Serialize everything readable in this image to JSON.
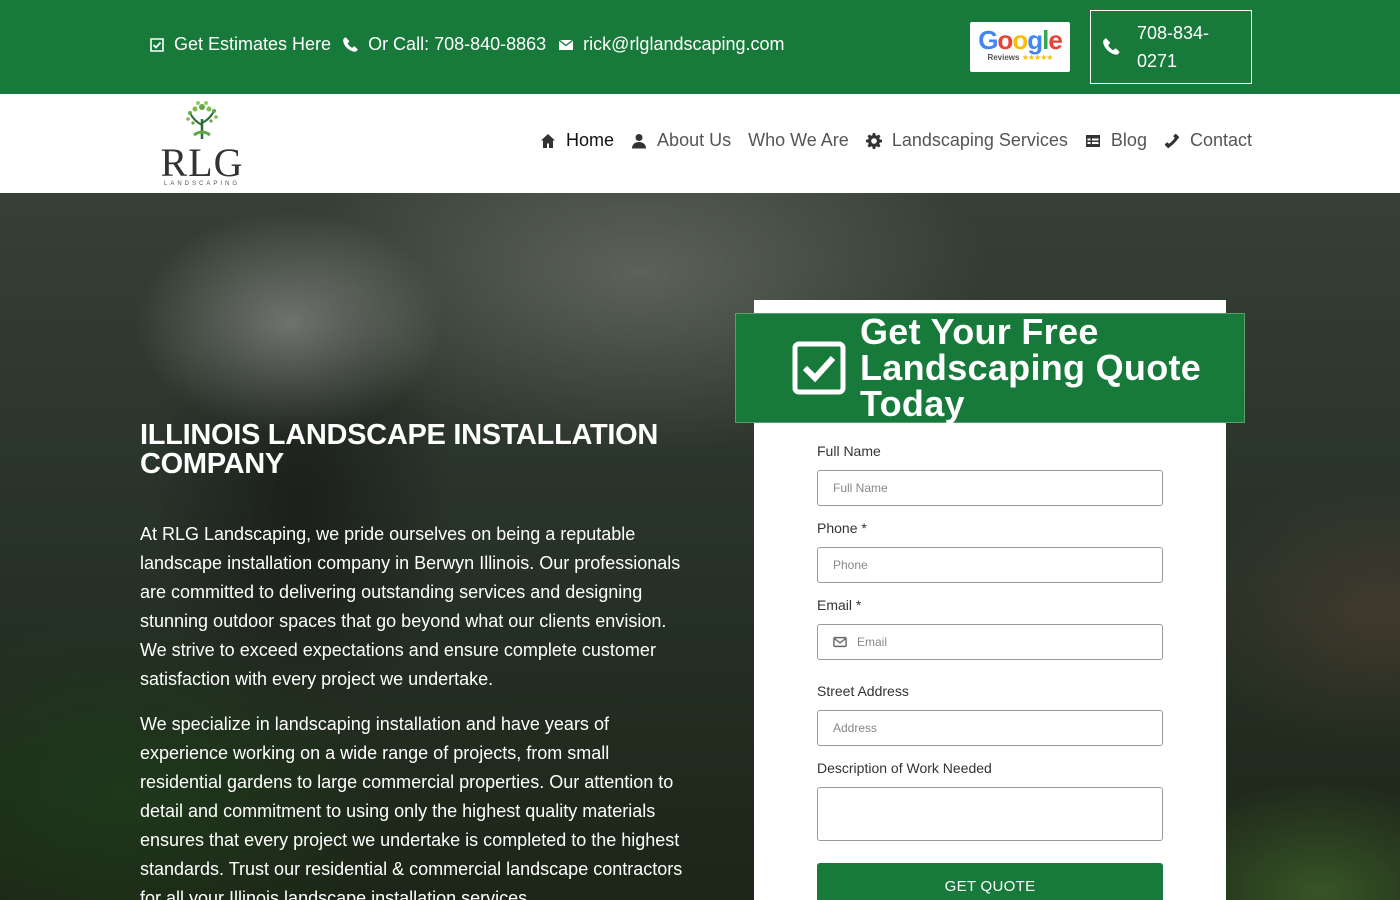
{
  "topbar": {
    "estimates_label": "Get Estimates Here",
    "call_label": "Or Call: 708-840-8863",
    "email": "rick@rlglandscaping.com",
    "google_word": [
      "G",
      "o",
      "o",
      "g",
      "l",
      "e"
    ],
    "google_sub": "Reviews",
    "google_stars": "★★★★★",
    "phone_button": "708-834-0271"
  },
  "header": {
    "logo_word": "RLG",
    "logo_sub": "LANDSCAPING",
    "nav": [
      {
        "label": "Home",
        "icon": "home-icon",
        "active": true
      },
      {
        "label": "About Us",
        "icon": "user-icon"
      },
      {
        "label": "Who We Are"
      },
      {
        "label": "Landscaping Services",
        "icon": "gear-icon"
      },
      {
        "label": "Blog",
        "icon": "table-icon"
      },
      {
        "label": "Contact",
        "icon": "phone-icon"
      }
    ]
  },
  "hero": {
    "title": "ILLINOIS LANDSCAPE INSTALLATION COMPANY",
    "paragraphs": [
      "At RLG Landscaping, we pride ourselves on being a reputable landscape installation company in Berwyn Illinois. Our professionals are committed to delivering outstanding services and designing stunning outdoor spaces that go beyond what our clients envision. We strive to exceed expectations and ensure complete customer satisfaction with every project we undertake.",
      "We specialize in landscaping installation and have years of experience working on a wide range of projects, from small residential gardens to large commercial properties. Our attention to detail and commitment to using only the highest quality materials ensures that every project we undertake is completed to the highest standards. Trust our residential & commercial landscape contractors for all your Illinois landscape installation services."
    ]
  },
  "quote": {
    "title": "Get Your Free Landscaping Quote Today",
    "fields": {
      "full_name_label": "Full Name",
      "full_name_placeholder": "Full Name",
      "phone_label": "Phone *",
      "phone_placeholder": "Phone",
      "email_label": "Email *",
      "email_placeholder": "Email",
      "address_label": "Street Address",
      "address_placeholder": "Address",
      "description_label": "Description of Work Needed"
    },
    "submit_label": "GET QUOTE"
  },
  "colors": {
    "brand_green": "#177a3a"
  }
}
